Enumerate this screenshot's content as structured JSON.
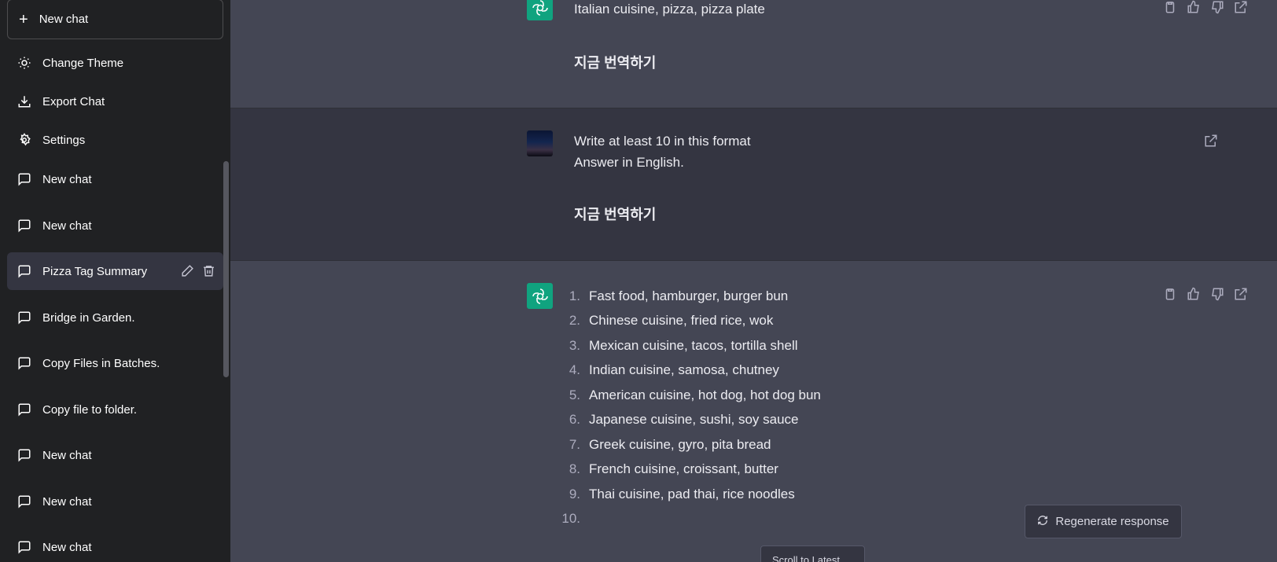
{
  "sidebar": {
    "new_chat_label": "New chat",
    "change_theme": "Change Theme",
    "export_chat": "Export Chat",
    "settings": "Settings",
    "chats": [
      {
        "label": "New chat"
      },
      {
        "label": "New chat"
      },
      {
        "label": "Pizza Tag Summary",
        "active": true
      },
      {
        "label": "Bridge in Garden."
      },
      {
        "label": "Copy Files in Batches."
      },
      {
        "label": "Copy file to folder."
      },
      {
        "label": "New chat"
      },
      {
        "label": "New chat"
      },
      {
        "label": "New chat"
      }
    ]
  },
  "conversation": {
    "msg1": {
      "text": "Italian cuisine, pizza, pizza plate",
      "translate": "지금 번역하기"
    },
    "msg2": {
      "line1": "Write at least 10 in this format",
      "line2": "Answer in English.",
      "translate": "지금 번역하기"
    },
    "msg3": {
      "items": [
        {
          "num": "1.",
          "text": "Fast food, hamburger, burger bun"
        },
        {
          "num": "2.",
          "text": "Chinese cuisine, fried rice, wok"
        },
        {
          "num": "3.",
          "text": "Mexican cuisine, tacos, tortilla shell"
        },
        {
          "num": "4.",
          "text": "Indian cuisine, samosa, chutney"
        },
        {
          "num": "5.",
          "text": "American cuisine, hot dog, hot dog bun"
        },
        {
          "num": "6.",
          "text": "Japanese cuisine, sushi, soy sauce"
        },
        {
          "num": "7.",
          "text": "Greek cuisine, gyro, pita bread"
        },
        {
          "num": "8.",
          "text": "French cuisine, croissant, butter"
        },
        {
          "num": "9.",
          "text": "Thai cuisine, pad thai, rice noodles"
        },
        {
          "num": "10.",
          "text": ""
        }
      ]
    }
  },
  "regenerate_label": "Regenerate response",
  "scroll_latest_label": "Scroll to Latest",
  "colors": {
    "sidebar_bg": "#202123",
    "assistant_bg": "#444654",
    "user_bg": "#343541",
    "gpt_avatar": "#10a37f"
  }
}
